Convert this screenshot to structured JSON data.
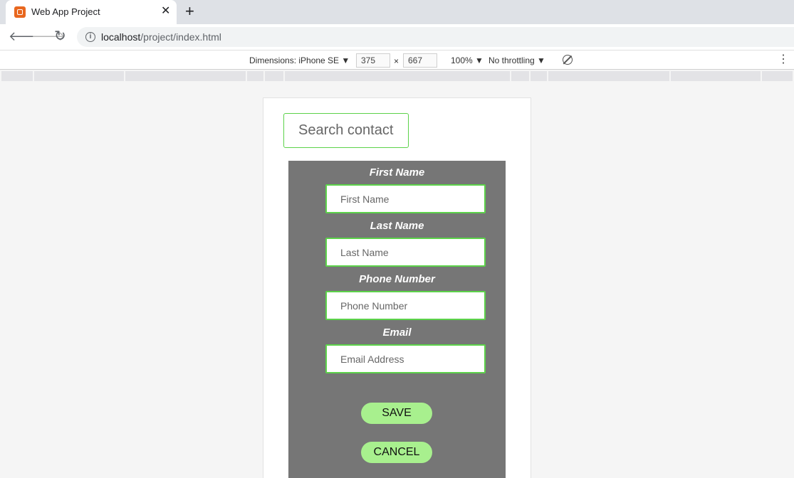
{
  "browser": {
    "tab": {
      "title": "Web App Project",
      "close_glyph": "✕"
    },
    "new_tab_glyph": "+",
    "url_host": "localhost",
    "url_path": "/project/index.html"
  },
  "devtools": {
    "dimensions_label": "Dimensions: iPhone SE ▼",
    "width": "375",
    "times": "×",
    "height": "667",
    "zoom": "100% ▼",
    "throttling": "No throttling ▼"
  },
  "page": {
    "search_placeholder": "Search contact",
    "fields": [
      {
        "label": "First Name",
        "placeholder": "First Name"
      },
      {
        "label": "Last Name",
        "placeholder": "Last Name"
      },
      {
        "label": "Phone Number",
        "placeholder": "Phone Number"
      },
      {
        "label": "Email",
        "placeholder": "Email Address"
      }
    ],
    "save_label": "SAVE",
    "cancel_label": "CANCEL"
  },
  "colors": {
    "panel": "#767676",
    "input_border": "#5cd24a",
    "button": "#a8f08e"
  }
}
